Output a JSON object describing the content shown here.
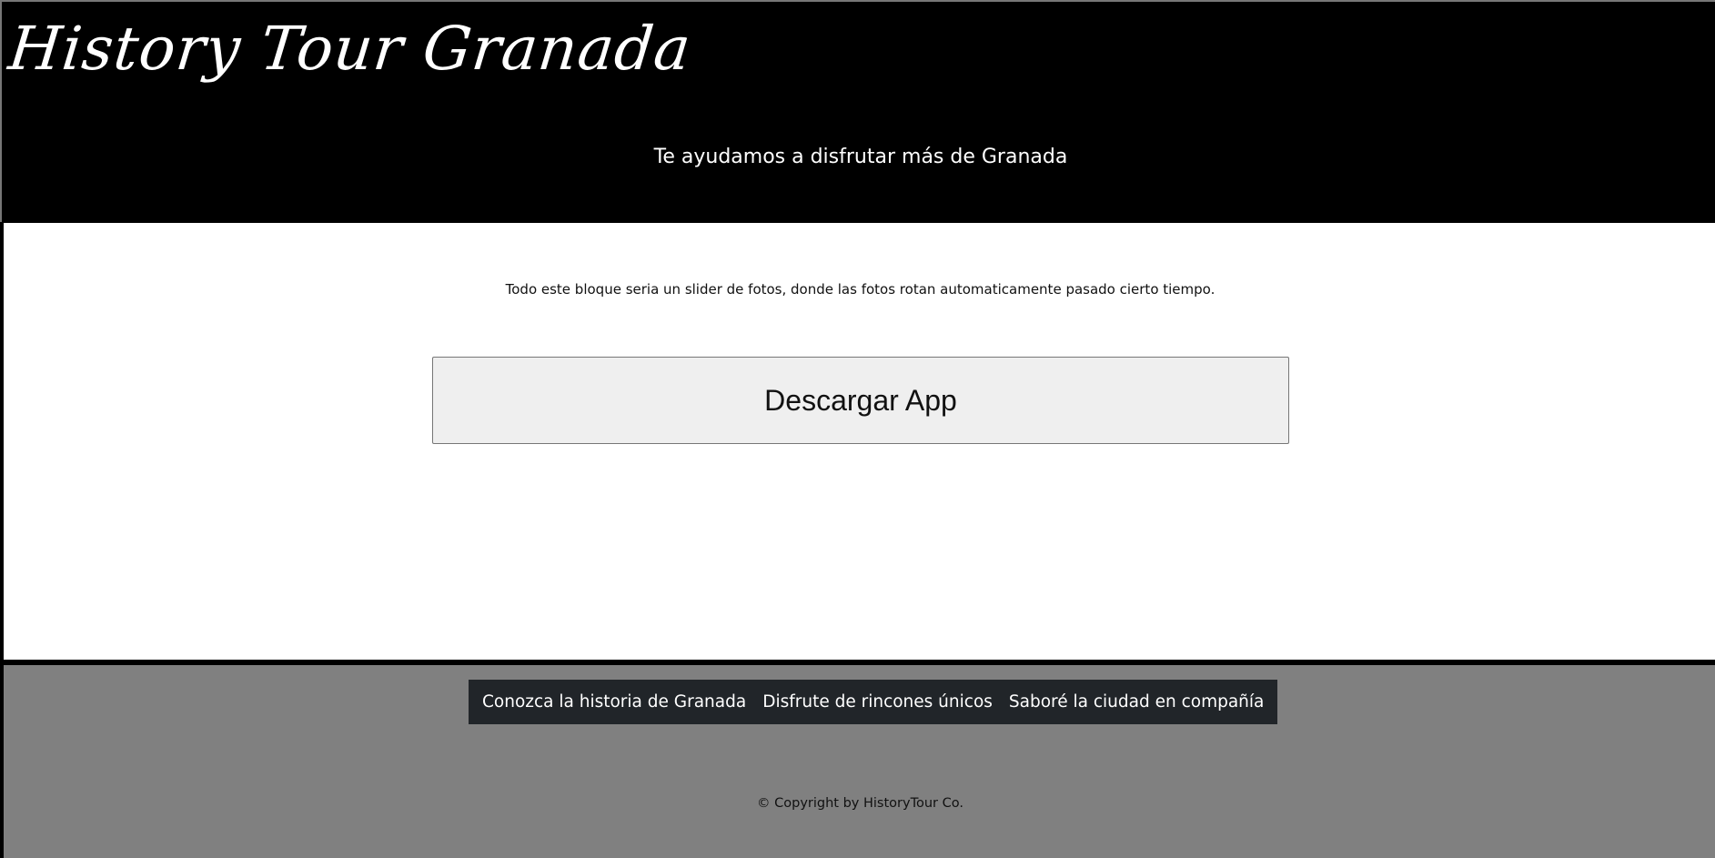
{
  "header": {
    "logo_text": "History Tour Granada",
    "tagline": "Te ayudamos a disfrutar más de Granada"
  },
  "main": {
    "slider_note": "Todo este bloque seria un slider de fotos, donde las fotos rotan automaticamente pasado cierto tiempo.",
    "download_button_label": "Descargar App"
  },
  "footer": {
    "nav": [
      {
        "label": "Conozca la historia de Granada"
      },
      {
        "label": "Disfrute de rincones únicos"
      },
      {
        "label": "Saboré la ciudad en compañía"
      }
    ],
    "copyright": "© Copyright by HistoryTour Co."
  },
  "colors": {
    "header_bg": "#000000",
    "main_bg": "#ffffff",
    "footer_bg": "#808080",
    "footer_nav_bg": "#212529",
    "button_bg": "#efefef"
  }
}
